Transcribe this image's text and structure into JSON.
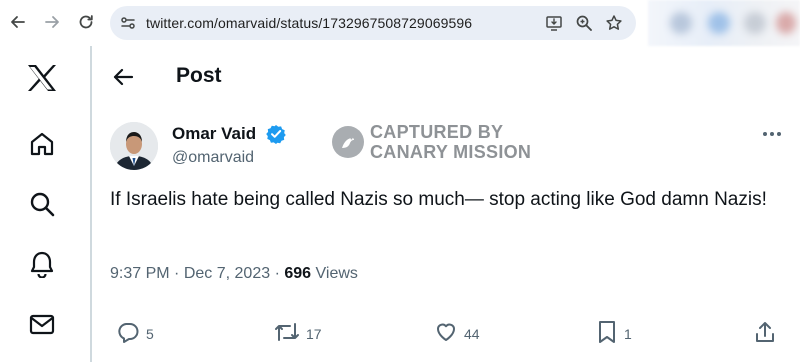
{
  "browser": {
    "url": "twitter.com/omarvaid/status/1732967508729069596",
    "icons": [
      "back-arrow-icon",
      "forward-arrow-icon",
      "reload-icon",
      "site-info-icon",
      "install-app-icon",
      "zoom-icon",
      "bookmark-star-icon"
    ]
  },
  "sidebar": {
    "items": [
      {
        "name": "x-logo-icon"
      },
      {
        "name": "home-icon"
      },
      {
        "name": "search-icon"
      },
      {
        "name": "notifications-bell-icon"
      },
      {
        "name": "messages-envelope-icon"
      }
    ]
  },
  "header": {
    "title": "Post"
  },
  "tweet": {
    "author_name": "Omar Vaid",
    "handle": "@omarvaid",
    "verified": true,
    "text": "If Israelis hate being called Nazis so much— stop acting like God damn Nazis!",
    "time": "9:37 PM",
    "sep1": "·",
    "date": "Dec 7, 2023",
    "sep2": "·",
    "views": "696",
    "views_label": "Views",
    "replies": "5",
    "reposts": "17",
    "likes": "44",
    "bookmarks": "1"
  },
  "watermark": {
    "line1": "CAPTURED BY",
    "line2": "CANARY MISSION"
  },
  "colors": {
    "verified_blue": "#1d9bf0",
    "text": "#0f1419",
    "secondary": "#536471",
    "omnibox": "#e9eef6"
  }
}
